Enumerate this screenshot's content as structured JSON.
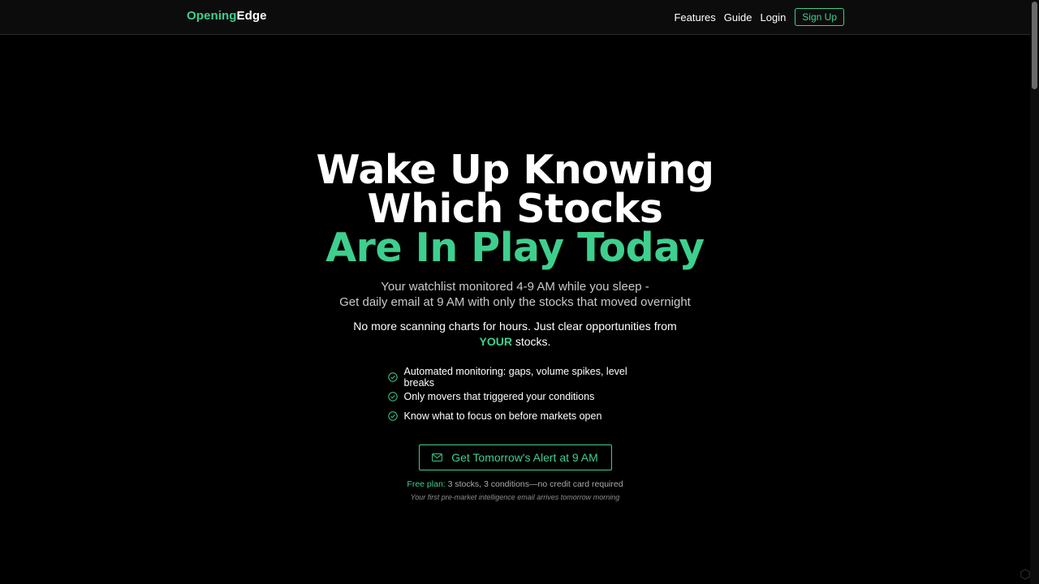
{
  "nav": {
    "brand_part1": "Opening",
    "brand_part2": "Edge",
    "links": [
      "Features",
      "Guide",
      "Login"
    ],
    "signup_label": "Sign Up"
  },
  "hero": {
    "headline_line1": "Wake Up Knowing",
    "headline_line2": "Which Stocks",
    "headline_line3": "Are In Play Today",
    "subtitle_line1": "Your watchlist monitored 4-9 AM while you sleep -",
    "subtitle_line2": "Get daily email at 9 AM with only the stocks that moved overnight",
    "tagline_pre": "No more scanning charts for hours. Just clear opportunities from ",
    "tagline_highlight": "YOUR",
    "tagline_post": " stocks.",
    "features": [
      "Automated monitoring: gaps, volume spikes, level breaks",
      "Only movers that triggered your conditions",
      "Know what to focus on before markets open"
    ],
    "cta_label": "Get Tomorrow's Alert at 9 AM",
    "free_plan_label": "Free plan:",
    "free_plan_text": " 3 stocks, 3 conditions—no credit card required",
    "first_email_note": "Your first pre-market intelligence email arrives tomorrow morning"
  },
  "colors": {
    "accent": "#3ecf8e",
    "background": "#000000",
    "navbar": "#0c0c0c"
  },
  "icons": {
    "feature_bullet": "check-circle-icon",
    "cta": "mail-icon"
  }
}
